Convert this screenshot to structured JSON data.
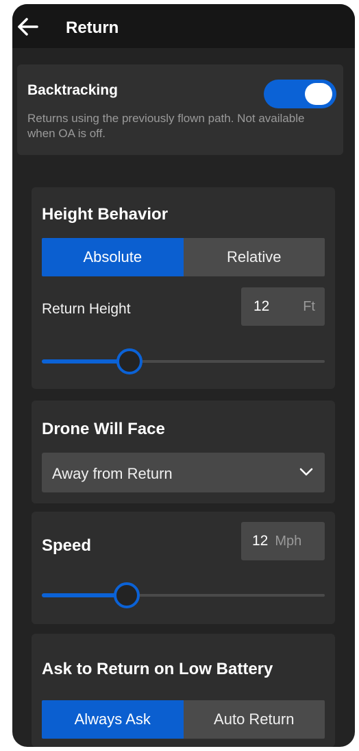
{
  "header": {
    "title": "Return",
    "back_icon": "arrow-left-icon"
  },
  "backtracking": {
    "title": "Backtracking",
    "description": "Returns using the previously flown path. Not available when OA is off.",
    "enabled": true
  },
  "height_behavior": {
    "title": "Height Behavior",
    "options": [
      "Absolute",
      "Relative"
    ],
    "selected": "Absolute",
    "return_height_label": "Return Height",
    "return_height_value": "12",
    "return_height_unit": "Ft",
    "slider_fraction": 0.31
  },
  "drone_face": {
    "title": "Drone Will Face",
    "selected": "Away from Return",
    "chevron_icon": "chevron-down-icon"
  },
  "speed": {
    "title": "Speed",
    "value": "12",
    "unit": "Mph",
    "slider_fraction": 0.3
  },
  "low_battery": {
    "title": "Ask to Return on Low Battery",
    "options": [
      "Always Ask",
      "Auto Return"
    ],
    "selected": "Always Ask"
  },
  "colors": {
    "accent": "#0b62d6",
    "background": "#232323",
    "card": "#2e2e2e",
    "control": "#484848"
  }
}
